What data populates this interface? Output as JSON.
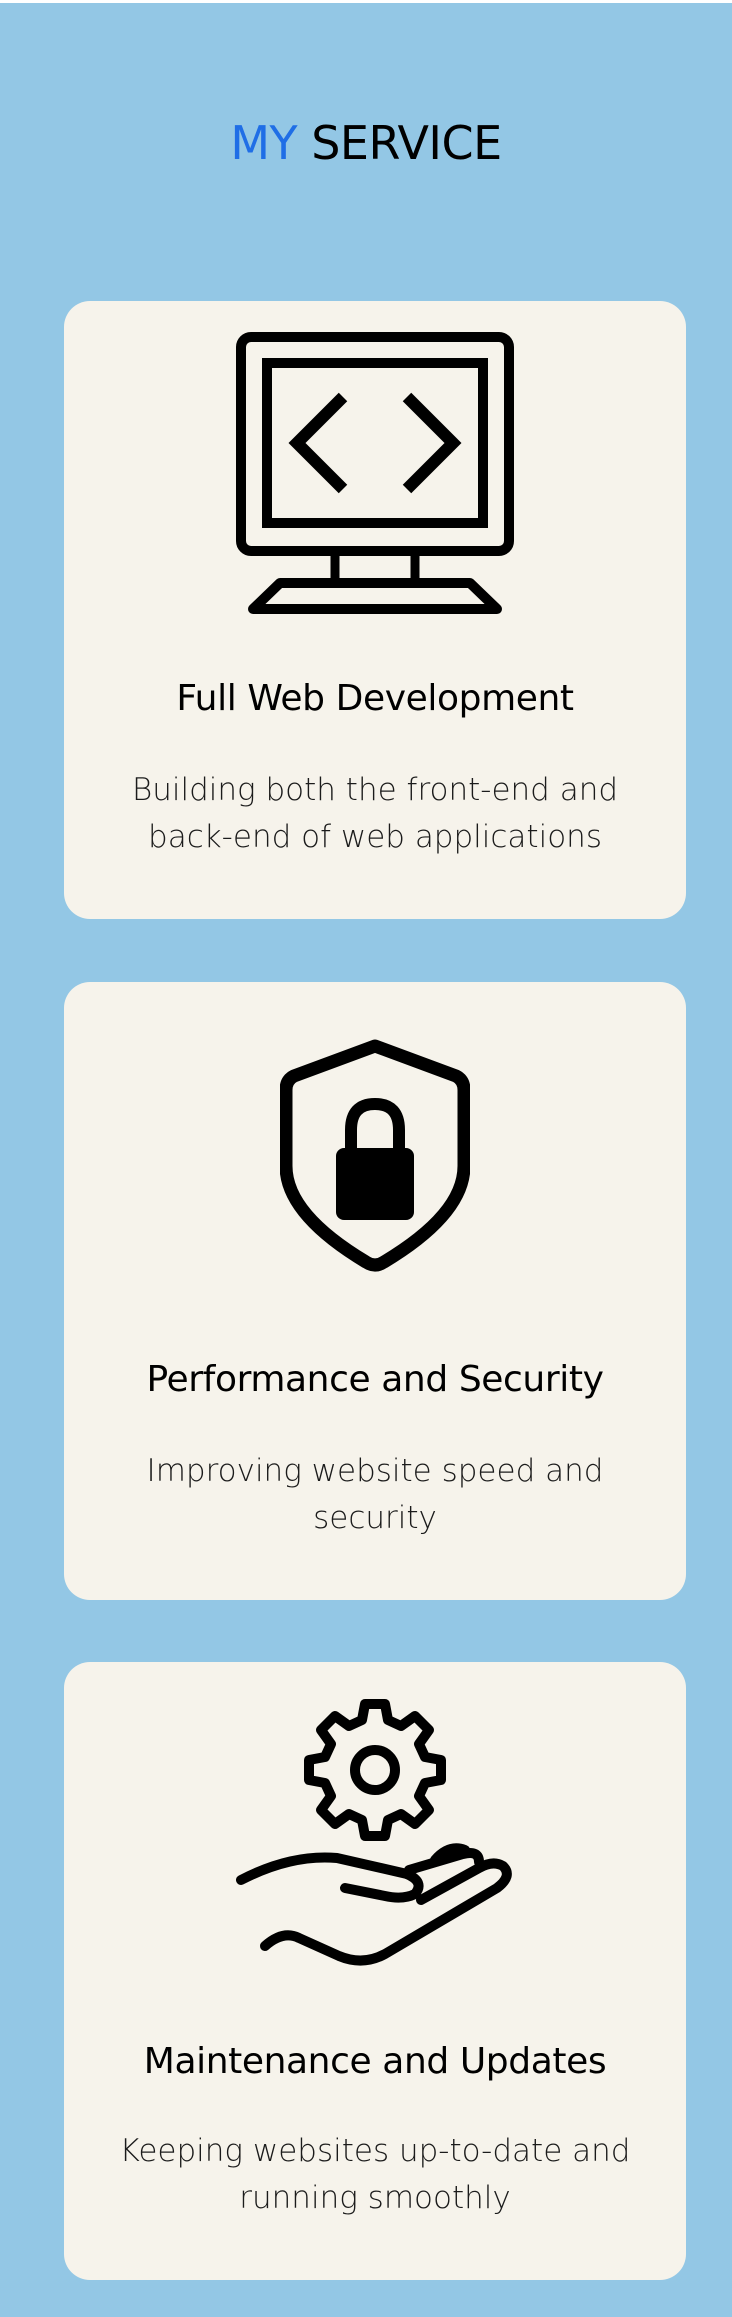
{
  "header": {
    "title_accent": "MY",
    "title_rest": "SERVICE",
    "accent_color": "#1f6ee6"
  },
  "services": [
    {
      "icon": "code-monitor-icon",
      "title": "Full Web Development",
      "description": "Building both the front-end and back-end of web applications"
    },
    {
      "icon": "shield-lock-icon",
      "title": "Performance and Security",
      "description": "Improving website speed and security"
    },
    {
      "icon": "gear-hand-icon",
      "title": "Maintenance and Updates",
      "description": "Keeping websites up-to-date and running smoothly"
    }
  ],
  "colors": {
    "background": "#93c7e5",
    "card": "#f6f3eb",
    "text": "#000000"
  }
}
